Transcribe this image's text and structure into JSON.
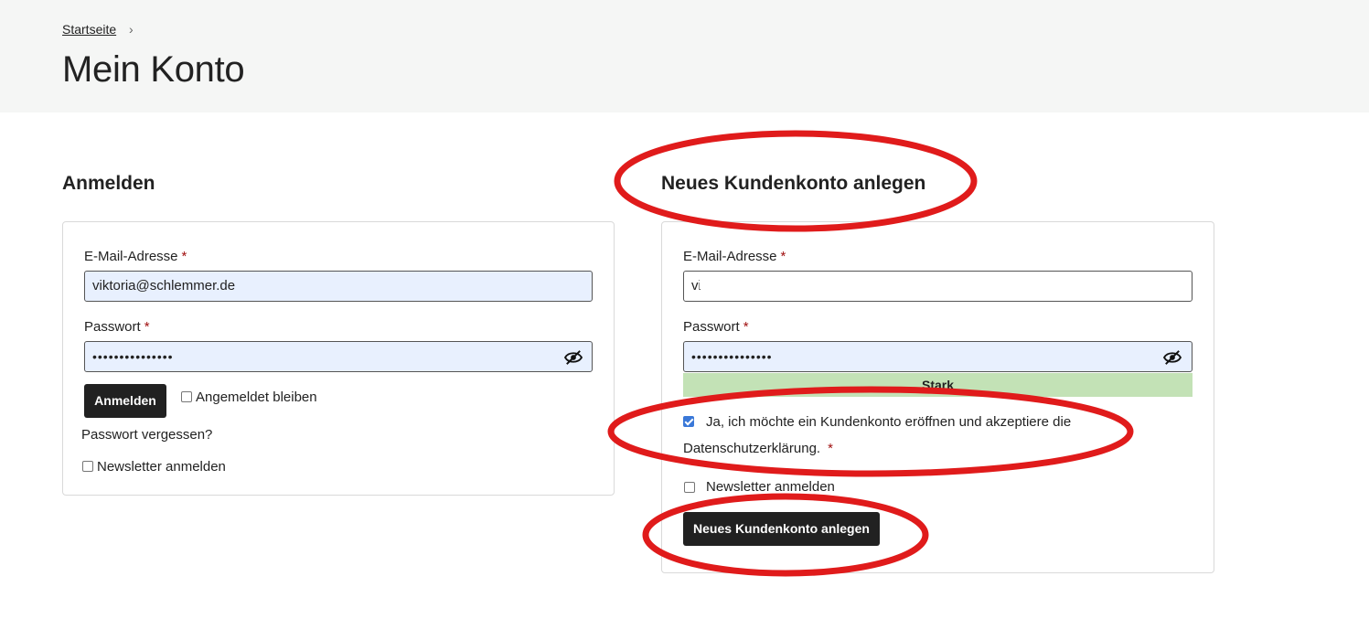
{
  "breadcrumb": {
    "home": "Startseite",
    "separator": "›"
  },
  "page_title": "Mein Konto",
  "login": {
    "title": "Anmelden",
    "email_label": "E-Mail-Adresse",
    "email_value": "viktoria@schlemmer.de",
    "password_label": "Passwort",
    "password_value": "•••••••••••••••",
    "required_marker": "*",
    "submit_label": "Anmelden",
    "remember_label": "Angemeldet bleiben",
    "forgot_label": "Passwort vergessen?",
    "newsletter_label": "Newsletter anmelden"
  },
  "register": {
    "title": "Neues Kundenkonto anlegen",
    "email_label": "E-Mail-Adresse",
    "email_value": "vi",
    "password_label": "Passwort",
    "password_value": "•••••••••••••••",
    "required_marker": "*",
    "strength_label": "Stark",
    "consent_line1": "Ja, ich möchte ein Kundenkonto eröffnen und akzeptiere die",
    "consent_line2": "Datenschutzerklärung.",
    "newsletter_label": "Newsletter anmelden",
    "submit_label": "Neues Kundenkonto anlegen"
  },
  "annotation": {
    "color": "#e01b1b"
  }
}
